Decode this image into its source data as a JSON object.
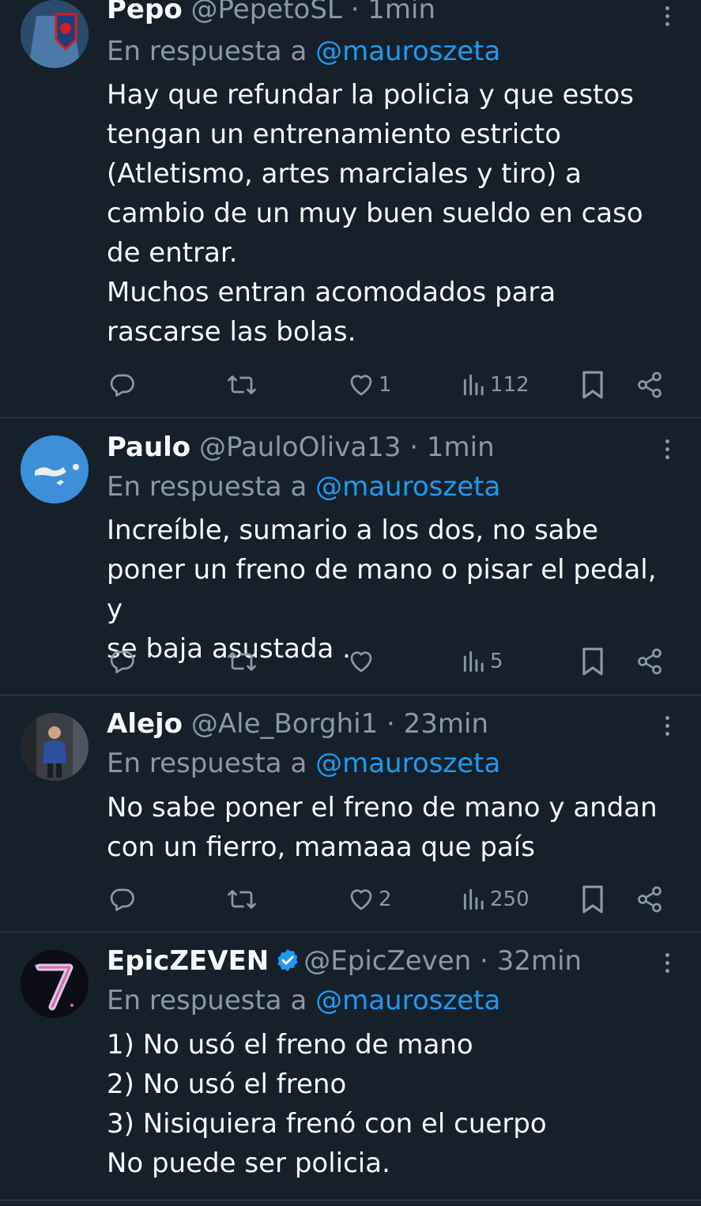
{
  "reply_prefix": "En respuesta a",
  "tweets": [
    {
      "name": "Pepo",
      "handle": "@PepetoSL",
      "time": "· 1min",
      "verified": false,
      "reply_to": "@mauroszeta",
      "text": "Hay que refundar la policia y que estos\ntengan un entrenamiento estricto\n(Atletismo, artes marciales y tiro) a\ncambio de un muy buen sueldo en caso\nde entrar.\nMuchos entran acomodados para\nrascarse las bolas.",
      "likes": "1",
      "views": "112"
    },
    {
      "name": "Paulo",
      "handle": "@PauloOliva13",
      "time": "· 1min",
      "verified": false,
      "reply_to": "@mauroszeta",
      "text": "Increíble, sumario a los dos, no sabe\nponer un freno de mano o pisar el pedal, y\nse baja asustada .",
      "likes": "",
      "views": "5"
    },
    {
      "name": "Alejo",
      "handle": "@Ale_Borghi1",
      "time": "· 23min",
      "verified": false,
      "reply_to": "@mauroszeta",
      "text": "No sabe poner el freno de mano y andan\ncon un fierro, mamaaa que país",
      "likes": "2",
      "views": "250"
    },
    {
      "name": "EpicZEVEN",
      "handle": "@EpicZeven",
      "time": "· 32min",
      "verified": true,
      "reply_to": "@mauroszeta",
      "text": "1) No usó el freno de mano\n2) No usó el freno\n3) Nisiquiera frenó con el cuerpo\nNo puede ser policia.",
      "likes": "",
      "views": ""
    }
  ],
  "colors": {
    "background": "#15202b",
    "text": "#f7f9f9",
    "secondary": "#8b98a5",
    "accent": "#1d9bf0",
    "divider": "#38444d"
  },
  "icons": [
    "reply-icon",
    "retweet-icon",
    "like-icon",
    "views-icon",
    "bookmark-icon",
    "share-icon",
    "more-icon",
    "verified-badge-icon"
  ]
}
